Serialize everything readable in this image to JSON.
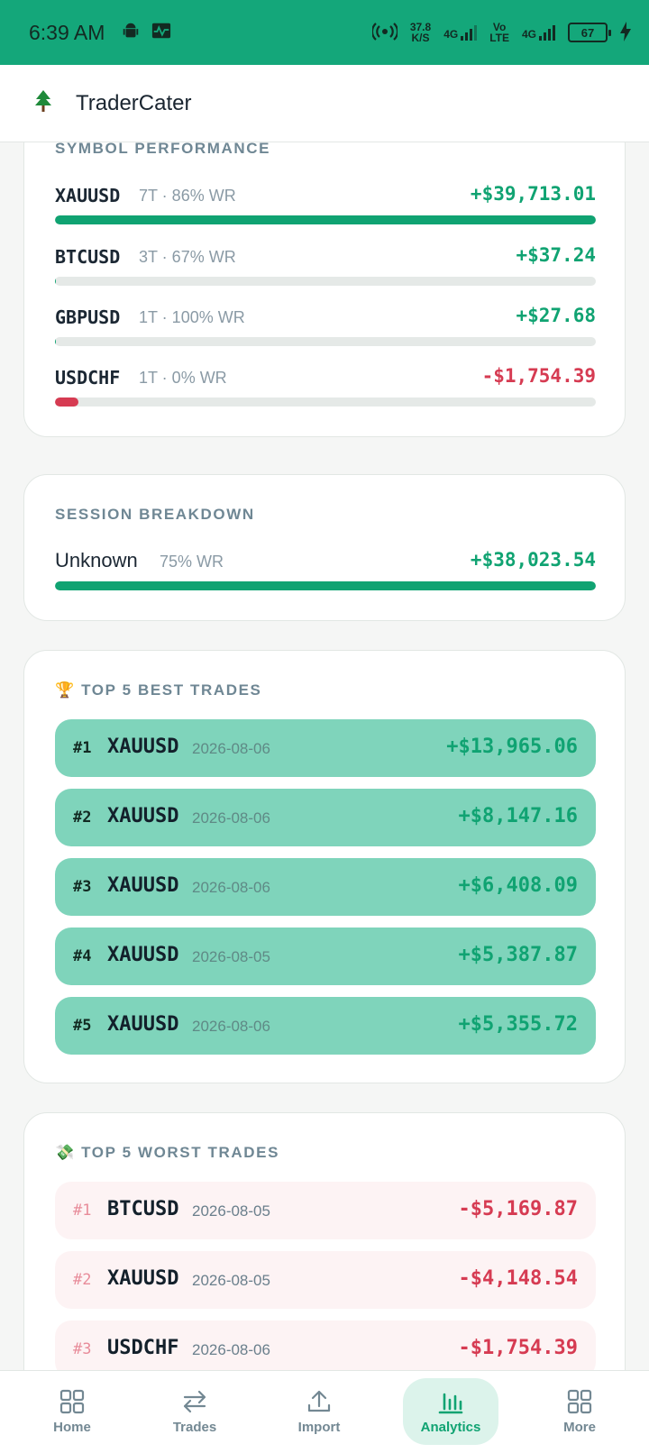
{
  "status_bar": {
    "time": "6:39 AM",
    "net_speed_value": "37.8",
    "net_speed_unit": "K/S",
    "net1": "4G",
    "volte_top": "Vo",
    "volte_bottom": "LTE",
    "net2": "4G",
    "battery": "67"
  },
  "app": {
    "title": "TraderCater",
    "logo_icon": "tree-icon",
    "accent": "#14a77a"
  },
  "symbol_performance": {
    "label": "SYMBOL PERFORMANCE",
    "rows": [
      {
        "symbol": "XAUUSD",
        "meta": "7T · 86% WR",
        "pnl": "+$39,713.01",
        "share": 1.0,
        "positive": true
      },
      {
        "symbol": "BTCUSD",
        "meta": "3T · 67% WR",
        "pnl": "+$37.24",
        "share": 0.002,
        "positive": true
      },
      {
        "symbol": "GBPUSD",
        "meta": "1T · 100% WR",
        "pnl": "+$27.68",
        "share": 0.002,
        "positive": true
      },
      {
        "symbol": "USDCHF",
        "meta": "1T · 0% WR",
        "pnl": "-$1,754.39",
        "share": 0.044,
        "positive": false
      }
    ]
  },
  "session_breakdown": {
    "label": "SESSION BREAKDOWN",
    "rows": [
      {
        "session": "Unknown",
        "meta": "75% WR",
        "pnl": "+$38,023.54",
        "share": 1.0
      }
    ]
  },
  "best_trades": {
    "emoji": "🏆",
    "label": "TOP 5 BEST TRADES",
    "items": [
      {
        "rank": "#1",
        "symbol": "XAUUSD",
        "date": "2026-08-06",
        "pnl": "+$13,965.06"
      },
      {
        "rank": "#2",
        "symbol": "XAUUSD",
        "date": "2026-08-06",
        "pnl": "+$8,147.16"
      },
      {
        "rank": "#3",
        "symbol": "XAUUSD",
        "date": "2026-08-06",
        "pnl": "+$6,408.09"
      },
      {
        "rank": "#4",
        "symbol": "XAUUSD",
        "date": "2026-08-05",
        "pnl": "+$5,387.87"
      },
      {
        "rank": "#5",
        "symbol": "XAUUSD",
        "date": "2026-08-06",
        "pnl": "+$5,355.72"
      }
    ]
  },
  "worst_trades": {
    "emoji": "💸",
    "label": "TOP 5 WORST TRADES",
    "items": [
      {
        "rank": "#1",
        "symbol": "BTCUSD",
        "date": "2026-08-05",
        "pnl": "-$5,169.87"
      },
      {
        "rank": "#2",
        "symbol": "XAUUSD",
        "date": "2026-08-05",
        "pnl": "-$4,148.54"
      },
      {
        "rank": "#3",
        "symbol": "USDCHF",
        "date": "2026-08-06",
        "pnl": "-$1,754.39"
      }
    ]
  },
  "bottom_nav": {
    "items": [
      {
        "label": "Home",
        "icon": "grid-icon",
        "active": false
      },
      {
        "label": "Trades",
        "icon": "swap-arrows-icon",
        "active": false
      },
      {
        "label": "Import",
        "icon": "upload-icon",
        "active": false
      },
      {
        "label": "Analytics",
        "icon": "bar-chart-icon",
        "active": true
      },
      {
        "label": "More",
        "icon": "grid-icon",
        "active": false
      }
    ]
  }
}
